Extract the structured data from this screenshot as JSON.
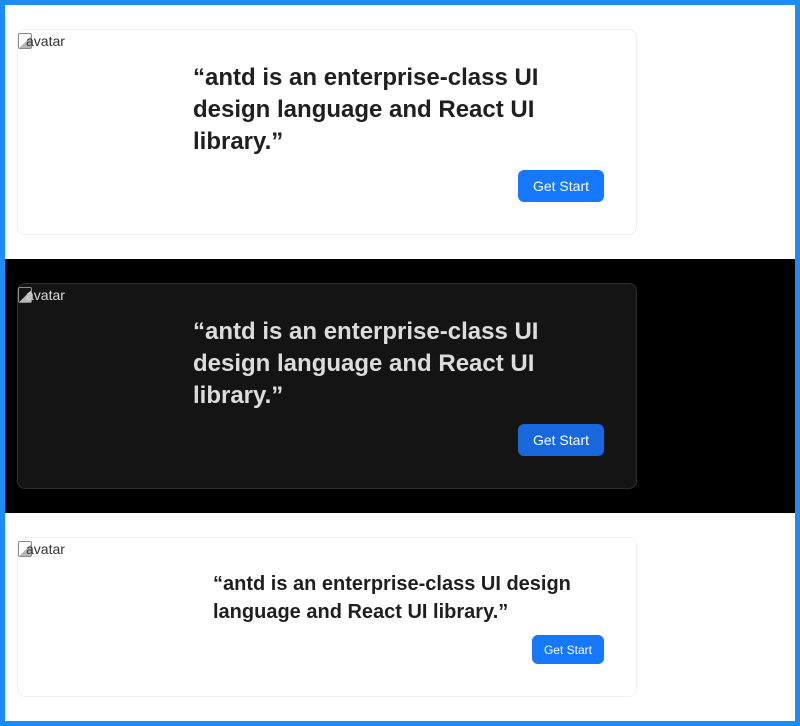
{
  "colors": {
    "accent": "#1677ff",
    "frame": "#1e8cf5",
    "dark_bg": "#000000",
    "dark_card": "#141414"
  },
  "cards": [
    {
      "theme": "light",
      "avatar_alt": "avatar",
      "quote": "“antd is an enterprise-class UI design language and React UI library.”",
      "button_label": "Get Start"
    },
    {
      "theme": "dark",
      "avatar_alt": "avatar",
      "quote": "“antd is an enterprise-class UI design language and React UI library.”",
      "button_label": "Get Start"
    },
    {
      "theme": "light-small",
      "avatar_alt": "avatar",
      "quote": "“antd is an enterprise-class UI design language and React UI library.”",
      "button_label": "Get Start"
    }
  ]
}
